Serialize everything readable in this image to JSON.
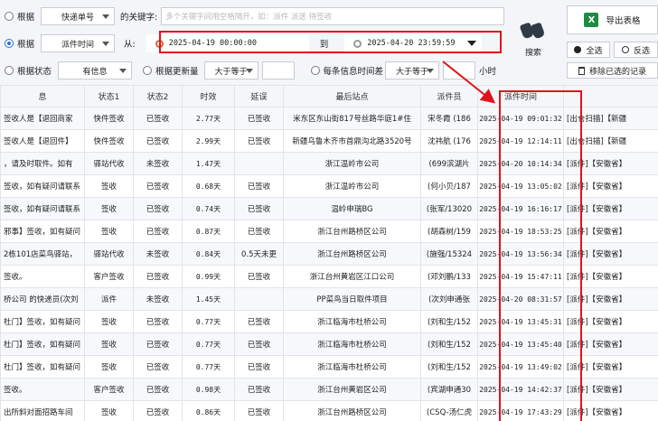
{
  "filters": {
    "row1": {
      "label": "根据",
      "field_value": "快递单号",
      "keyword_label": "的关键字:",
      "keyword_placeholder": "多个关键字间用空格隔开，如：派件 派送 待签收"
    },
    "row2": {
      "label": "根据",
      "field_value": "派件时间",
      "from_label": "从:",
      "from_value": "2025-04-19 00:00:00",
      "to_label": "到",
      "to_value": "2025-04-20 23:59:59"
    },
    "row3": {
      "status_label": "根据状态",
      "status_value": "有信息",
      "update_label": "根据更新量",
      "update_op": "大于等于",
      "update_value": "",
      "diff_label": "每条信息时间差",
      "diff_op": "大于等于",
      "diff_value": "",
      "diff_unit": "小时"
    },
    "search_label": "搜索"
  },
  "panel": {
    "export_label": "导出表格",
    "select_all": "全选",
    "invert": "反选",
    "remove_selected": "移除已选的记录"
  },
  "table": {
    "columns": [
      "息",
      "状态1",
      "状态2",
      "时效",
      "延误",
      "最后站点",
      "派件员",
      "派件时间",
      ""
    ],
    "rows": [
      [
        "签收人是【退回商家",
        "快件签收",
        "已签收",
        "2.77天",
        "已签收",
        "米东区东山街817号丝路华庭1#住",
        "宋冬霞 (186",
        "2025-04-19 09:01:32",
        "[出仓扫描]【新疆"
      ],
      [
        "签收人是【退回件】",
        "快件签收",
        "已签收",
        "2.99天",
        "已签收",
        "新疆乌鲁木齐市首鼎沟北路3520号",
        "沈祎航 (176",
        "2025-04-19 12:14:11",
        "[出仓扫描]【新疆"
      ],
      [
        "，请及时取件。如有",
        "驿站代收",
        "未签收",
        "1.47天",
        "",
        "浙江温岭市公司",
        "(699滨湖片",
        "2025-04-20 10:14:34",
        "[派件]【安徽省】"
      ],
      [
        "签收，如有疑问请联系",
        "签收",
        "已签收",
        "0.68天",
        "已签收",
        "浙江温岭市公司",
        "(何小贝/187",
        "2025-04-19 13:05:02",
        "[派件]【安徽省】"
      ],
      [
        "签收，如有疑问请联系",
        "签收",
        "已签收",
        "0.74天",
        "已签收",
        "温岭申瑞BG",
        "(张军/13020",
        "2025-04-19 16:16:17",
        "[派件]【安徽省】"
      ],
      [
        "邪事】签收，如有疑问",
        "签收",
        "已签收",
        "0.87天",
        "已签收",
        "浙江台州路桥区公司",
        "(胡森树/159",
        "2025-04-19 18:53:25",
        "[派件]【安徽省】"
      ],
      [
        "2栋101店菜鸟驿站，",
        "驿站代收",
        "未签收",
        "0.84天",
        "0.5天未更",
        "浙江台州路桥区公司",
        "(施强/15324",
        "2025-04-19 13:56:34",
        "[派件]【安徽省】"
      ],
      [
        "签收。",
        "客户签收",
        "已签收",
        "0.99天",
        "已签收",
        "浙江台州黄岩区江口公司",
        "(邓刘鹏/133",
        "2025-04-19 15:47:11",
        "[派件]【安徽省】"
      ],
      [
        "桥公司 的快递员(次刘",
        "派件",
        "未签收",
        "1.45天",
        "",
        "PP菜鸟当日取件项目",
        "(次刘申通张",
        "2025-04-20 08:31:57",
        "[派件]【安徽省】"
      ],
      [
        "杜门】签收，如有疑问",
        "签收",
        "已签收",
        "0.77天",
        "已签收",
        "浙江临海市杜桥公司",
        "(刘和生/152",
        "2025-04-19 13:45:31",
        "[派件]【安徽省】"
      ],
      [
        "杜门】签收，如有疑问",
        "签收",
        "已签收",
        "0.77天",
        "已签收",
        "浙江临海市杜桥公司",
        "(刘和生/152",
        "2025-04-19 13:45:40",
        "[派件]【安徽省】"
      ],
      [
        "杜门】签收，如有疑问",
        "签收",
        "已签收",
        "0.77天",
        "已签收",
        "浙江临海市杜桥公司",
        "(刘和生/152",
        "2025-04-19 13:49:02",
        "[派件]【安徽省】"
      ],
      [
        "签收。",
        "客户签收",
        "已签收",
        "0.98天",
        "已签收",
        "浙江台州黄岩区公司",
        "(宾湖申通30",
        "2025-04-19 14:42:37",
        "[派件]【安徽省】"
      ],
      [
        "出所斜对面招路车间",
        "签收",
        "已签收",
        "0.86天",
        "已签收",
        "浙江台州路桥区公司",
        "(CSQ-汤仁虎",
        "2025-04-19 17:43:29",
        "[派件]【安徽省】"
      ]
    ]
  }
}
